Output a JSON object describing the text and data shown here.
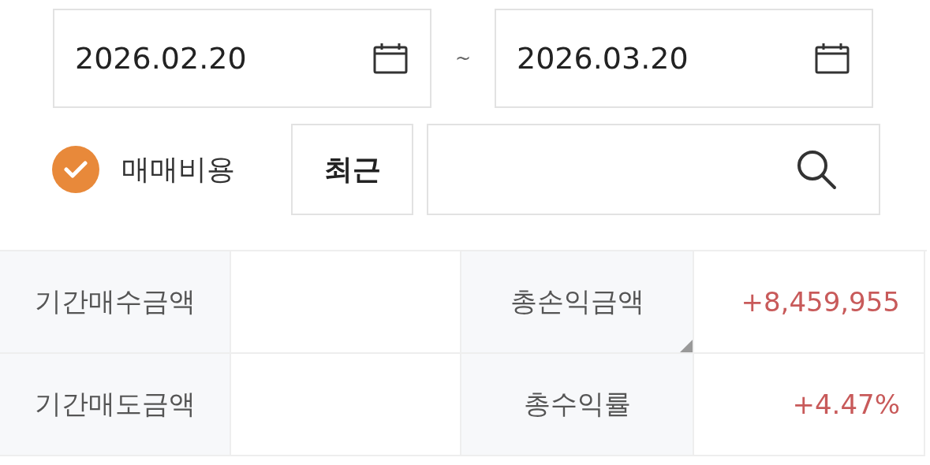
{
  "date_range": {
    "start": "2026.02.20",
    "separator": "~",
    "end": "2026.03.20"
  },
  "fee_checkbox": {
    "label": "매매비용",
    "checked": true
  },
  "recent_button": {
    "label": "최근"
  },
  "summary": [
    {
      "label": "기간매수금액",
      "label_2": "총손익금액",
      "value_2": "+8,459,955",
      "corner_mark": true
    },
    {
      "label": "기간매도금액",
      "label_2": "총수익률",
      "value_2": "+4.47%"
    }
  ]
}
